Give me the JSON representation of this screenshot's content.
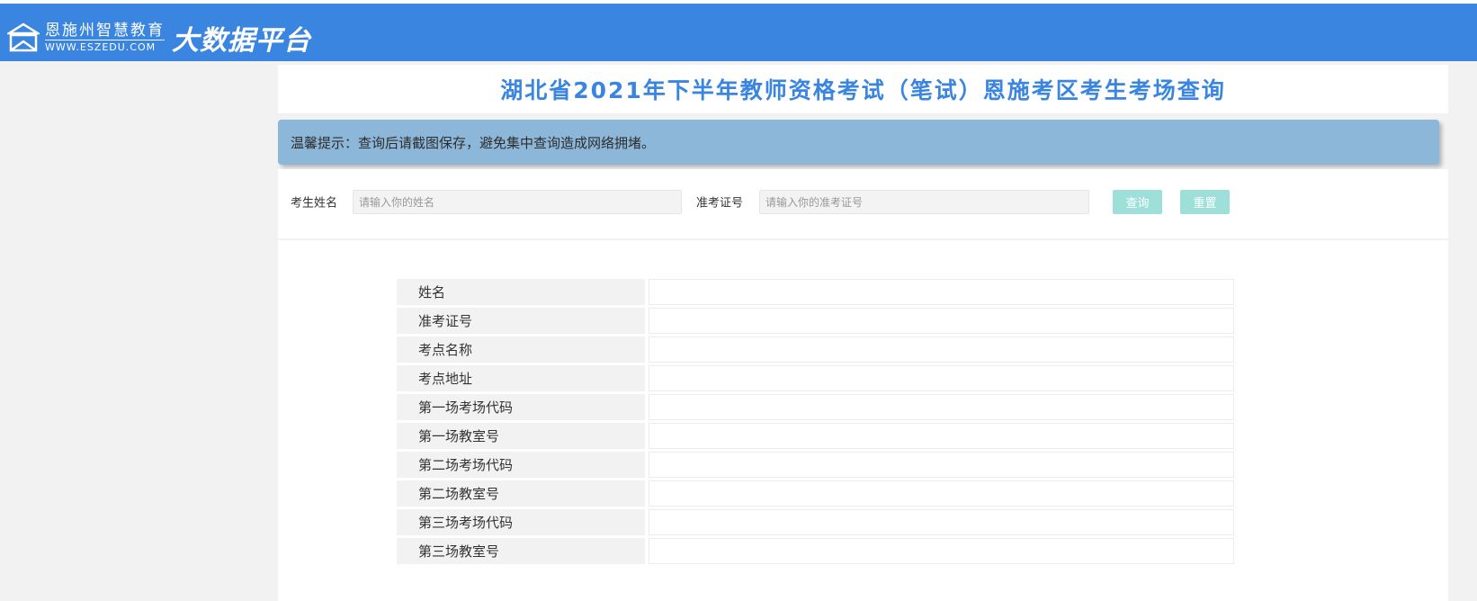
{
  "header": {
    "logo_cn": "恩施州智慧教育",
    "logo_en": "WWW.ESZEDU.COM",
    "logo_tagline": "大数据平台",
    "logo_icon": "house-logo-icon",
    "bar_color": "#3a85e0"
  },
  "page_title": "湖北省2021年下半年教师资格考试（笔试）恩施考区考生考场查询",
  "tip": "温馨提示：查询后请截图保存，避免集中查询造成网络拥堵。",
  "form": {
    "name_label": "考生姓名",
    "name_placeholder": "请输入你的姓名",
    "name_value": "",
    "ticket_label": "准考证号",
    "ticket_placeholder": "请输入你的准考证号",
    "ticket_value": "",
    "query_button": "查询",
    "reset_button": "重置",
    "button_color": "#9ee0d9"
  },
  "result": {
    "rows": [
      {
        "label": "姓名",
        "value": ""
      },
      {
        "label": "准考证号",
        "value": ""
      },
      {
        "label": "考点名称",
        "value": ""
      },
      {
        "label": "考点地址",
        "value": ""
      },
      {
        "label": "第一场考场代码",
        "value": ""
      },
      {
        "label": "第一场教室号",
        "value": ""
      },
      {
        "label": "第二场考场代码",
        "value": ""
      },
      {
        "label": "第二场教室号",
        "value": ""
      },
      {
        "label": "第三场考场代码",
        "value": ""
      },
      {
        "label": "第三场教室号",
        "value": ""
      }
    ]
  }
}
